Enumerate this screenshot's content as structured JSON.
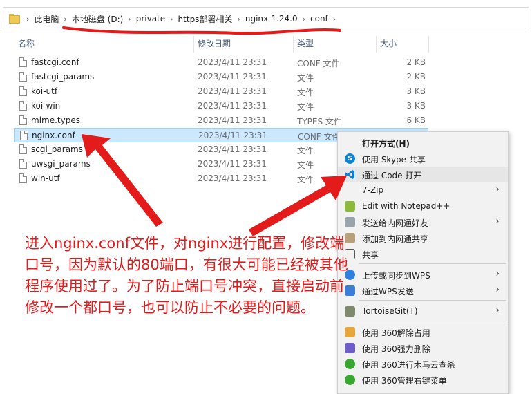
{
  "breadcrumb": [
    "此电脑",
    "本地磁盘 (D:)",
    "private",
    "https部署相关",
    "nginx-1.24.0",
    "conf"
  ],
  "columns": {
    "name": "名称",
    "date": "修改日期",
    "type": "类型",
    "size": "大小"
  },
  "files": [
    {
      "name": "fastcgi.conf",
      "date": "2023/4/11 23:31",
      "type": "CONF 文件",
      "size": "2 KB"
    },
    {
      "name": "fastcgi_params",
      "date": "2023/4/11 23:31",
      "type": "文件",
      "size": "2 KB"
    },
    {
      "name": "koi-utf",
      "date": "2023/4/11 23:31",
      "type": "文件",
      "size": "3 KB"
    },
    {
      "name": "koi-win",
      "date": "2023/4/11 23:31",
      "type": "文件",
      "size": "3 KB"
    },
    {
      "name": "mime.types",
      "date": "2023/4/11 23:31",
      "type": "TYPES 文件",
      "size": "6 KB"
    },
    {
      "name": "nginx.conf",
      "date": "2023/4/11 23:31",
      "type": "CONF 文件",
      "size": ""
    },
    {
      "name": "scgi_params",
      "date": "2023/4/11 23:31",
      "type": "文件",
      "size": ""
    },
    {
      "name": "uwsgi_params",
      "date": "2023/4/11 23:31",
      "type": "文件",
      "size": ""
    },
    {
      "name": "win-utf",
      "date": "2023/4/11 23:31",
      "type": "文件",
      "size": ""
    }
  ],
  "menu": [
    {
      "label": "打开方式(H)",
      "bold": true
    },
    {
      "label": "使用 Skype 共享",
      "icon": "skype-icon"
    },
    {
      "label": "通过 Code 打开",
      "icon": "vscode-icon"
    },
    {
      "label": "7-Zip",
      "submenu": true
    },
    {
      "label": "Edit with Notepad++",
      "icon": "notepad-plus-plus-icon"
    },
    {
      "label": "发送给内网通好友",
      "icon": "send-icon",
      "submenu": true
    },
    {
      "label": "添加到内网通共享",
      "icon": "add-share-icon"
    },
    {
      "label": "共享",
      "icon": "share-icon"
    },
    {
      "label": "上传或同步到WPS",
      "icon": "wps-cloud-icon",
      "submenu": true
    },
    {
      "label": "通过WPS发送",
      "icon": "wps-send-icon",
      "submenu": true
    },
    {
      "label": "TortoiseGit(T)",
      "icon": "tortoisegit-icon",
      "submenu": true
    },
    {
      "label": "使用 360解除占用",
      "icon": "unlock-360-icon"
    },
    {
      "label": "使用 360强力删除",
      "icon": "delete-360-icon"
    },
    {
      "label": "使用 360进行木马云查杀",
      "icon": "scan-360-icon"
    },
    {
      "label": "使用 360管理右键菜单",
      "icon": "menu-360-icon"
    }
  ],
  "annotation": "进入nginx.conf文件，对nginx进行配置，修改端口号，因为默认的80端口，有很大可能已经被其他程序使用过了。为了防止端口号冲突，直接启动前修改一个都口号，也可以防止不必要的问题。",
  "colors": {
    "annotation": "#e31b1b",
    "selection": "#cce8ff",
    "menu_bg": "#f2f2f2"
  }
}
